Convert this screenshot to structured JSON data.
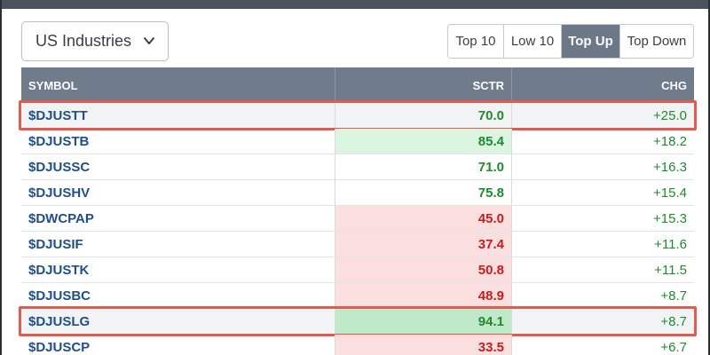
{
  "header": {
    "dropdown": {
      "label": "US Industries",
      "icon": "chevron-down-icon"
    },
    "tabs": [
      {
        "label": "Top 10",
        "active": false
      },
      {
        "label": "Low 10",
        "active": false
      },
      {
        "label": "Top Up",
        "active": true
      },
      {
        "label": "Top Down",
        "active": false
      }
    ]
  },
  "table": {
    "columns": [
      "SYMBOL",
      "SCTR",
      "CHG"
    ],
    "rows": [
      {
        "symbol": "$DJUSTT",
        "sctr": "70.0",
        "chg": "+25.0",
        "sctr_tone": "none",
        "highlighted": true
      },
      {
        "symbol": "$DJUSTB",
        "sctr": "85.4",
        "chg": "+18.2",
        "sctr_tone": "green",
        "highlighted": false
      },
      {
        "symbol": "$DJUSSC",
        "sctr": "71.0",
        "chg": "+16.3",
        "sctr_tone": "none",
        "highlighted": false
      },
      {
        "symbol": "$DJUSHV",
        "sctr": "75.8",
        "chg": "+15.4",
        "sctr_tone": "none",
        "highlighted": false
      },
      {
        "symbol": "$DWCPAP",
        "sctr": "45.0",
        "chg": "+15.3",
        "sctr_tone": "red",
        "highlighted": false
      },
      {
        "symbol": "$DJUSIF",
        "sctr": "37.4",
        "chg": "+11.6",
        "sctr_tone": "red",
        "highlighted": false
      },
      {
        "symbol": "$DJUSTK",
        "sctr": "50.8",
        "chg": "+11.5",
        "sctr_tone": "red",
        "highlighted": false
      },
      {
        "symbol": "$DJUSBC",
        "sctr": "48.9",
        "chg": "+8.7",
        "sctr_tone": "red",
        "highlighted": false
      },
      {
        "symbol": "$DJUSLG",
        "sctr": "94.1",
        "chg": "+8.7",
        "sctr_tone": "green-strong",
        "highlighted": true
      },
      {
        "symbol": "$DJUSCP",
        "sctr": "33.5",
        "chg": "+6.7",
        "sctr_tone": "red",
        "highlighted": false
      }
    ]
  },
  "colors": {
    "positive": "#1f8a2e",
    "negative": "#c41e1e",
    "header_bg": "#707c8c",
    "highlight_border": "#e35b4f",
    "active_tab": "#6c7887"
  }
}
